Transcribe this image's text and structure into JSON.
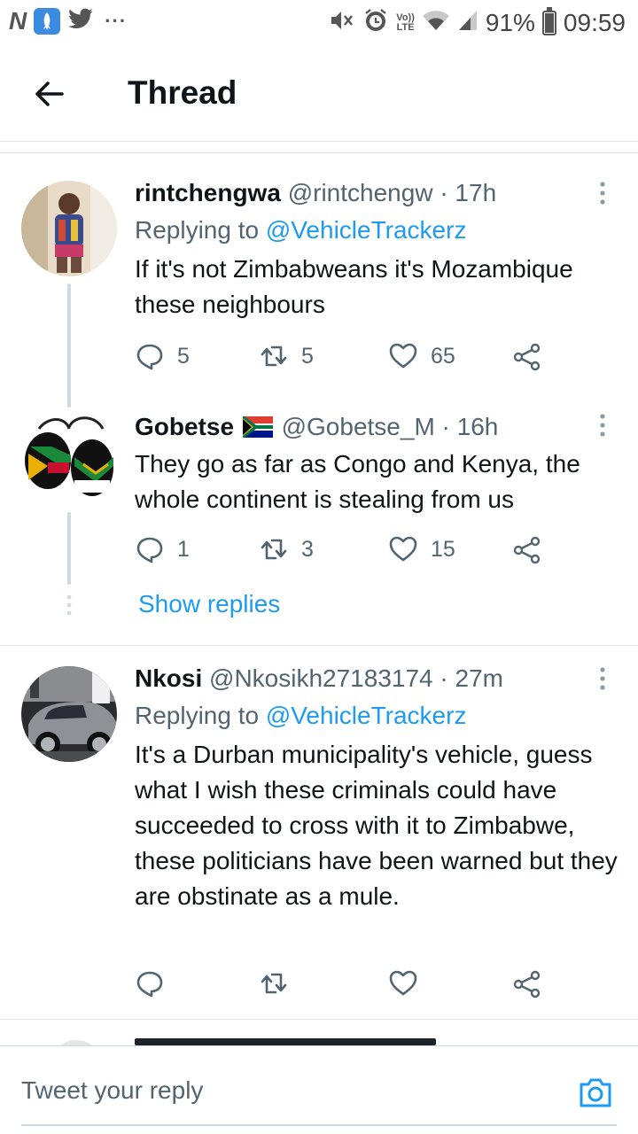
{
  "status_bar": {
    "left_glyph": "N",
    "rocket_icon": "rocket-app-icon",
    "bird_icon": "twitter-bird-icon",
    "more": "···",
    "volte_top": "Vo))",
    "volte_bottom": "LTE",
    "battery": "91%",
    "battery_level": 0.91,
    "time": "09:59"
  },
  "header": {
    "title": "Thread"
  },
  "tweets": [
    {
      "name": "rintchengwa",
      "handle": "@rintchengw",
      "time": "· 17h",
      "replying_prefix": "Replying to",
      "replying_to": "@VehicleTrackerz",
      "text": "If it's not Zimbabweans it's Mozambique these neighbours",
      "replies": "5",
      "retweets": "5",
      "likes": "65"
    },
    {
      "name": "Gobetse",
      "flag": "🇿🇦",
      "handle": "@Gobetse_M",
      "time": "· 16h",
      "text": "They go as far as Congo and Kenya, the whole continent is stealing from us",
      "replies": "1",
      "retweets": "3",
      "likes": "15"
    },
    {
      "name": "Nkosi",
      "handle": "@Nkosikh27183174",
      "time": "· 27m",
      "replying_prefix": "Replying to",
      "replying_to": "@VehicleTrackerz",
      "text": "It's a Durban municipality's vehicle, guess what I wish these criminals could have succeeded to cross with it to Zimbabwe, these politicians have been warned but they are obstinate as a mule."
    }
  ],
  "show_replies": "Show replies",
  "reply_bar": {
    "placeholder": "Tweet your reply"
  },
  "colors": {
    "accent": "#1d9bf0",
    "text": "#0f1419",
    "secondary": "#536471",
    "divider": "#e1e5e8"
  }
}
